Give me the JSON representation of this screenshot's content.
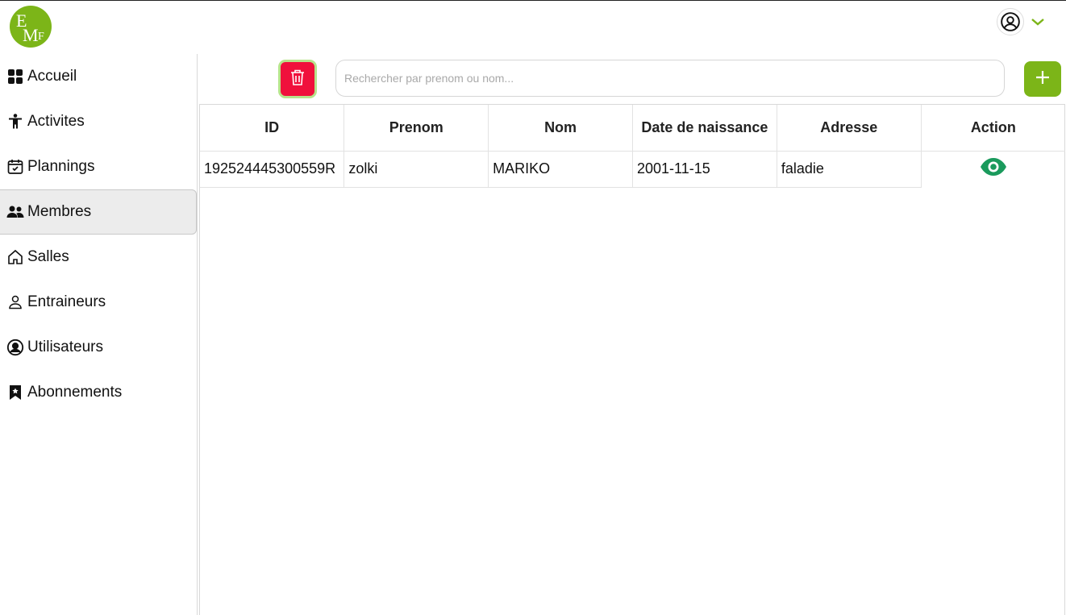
{
  "header": {
    "logo_icon": "em-logo",
    "user_icon": "user-circle-icon",
    "chevron_icon": "chevron-down-icon",
    "accent_color": "#7cb518"
  },
  "sidebar": {
    "items": [
      {
        "label": "Accueil",
        "icon": "grid-icon"
      },
      {
        "label": "Activites",
        "icon": "person-icon"
      },
      {
        "label": "Plannings",
        "icon": "calendar-check-icon"
      },
      {
        "label": "Membres",
        "icon": "people-icon",
        "active": true
      },
      {
        "label": "Salles",
        "icon": "house-icon"
      },
      {
        "label": "Entraineurs",
        "icon": "person-outline-icon"
      },
      {
        "label": "Utilisateurs",
        "icon": "user-circle-icon"
      },
      {
        "label": "Abonnements",
        "icon": "bookmark-star-icon"
      }
    ]
  },
  "toolbar": {
    "delete_icon": "trash-icon",
    "delete_color": "#f0103c",
    "search_placeholder": "Rechercher par prenom ou nom...",
    "search_value": "",
    "add_icon": "plus-icon"
  },
  "table": {
    "columns": [
      "ID",
      "Prenom",
      "Nom",
      "Date de naissance",
      "Adresse",
      "Action"
    ],
    "rows": [
      {
        "id": "192524445300559R",
        "prenom": "zolki",
        "nom": "MARIKO",
        "date_naissance": "2001-11-15",
        "adresse": "faladie",
        "action_icon": "eye-icon",
        "action_color": "#1a9a5c"
      }
    ]
  }
}
